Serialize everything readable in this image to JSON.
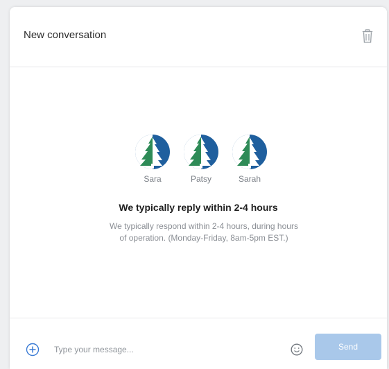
{
  "header": {
    "title": "New conversation",
    "delete_icon": "trash-icon"
  },
  "agents": [
    {
      "name": "Sara",
      "avatar_icon": "tree-logo-icon"
    },
    {
      "name": "Patsy",
      "avatar_icon": "tree-logo-icon"
    },
    {
      "name": "Sarah",
      "avatar_icon": "tree-logo-icon"
    }
  ],
  "availability": {
    "title": "We typically reply within 2-4 hours",
    "description_line1": "We typically respond within 2-4 hours, during hours",
    "description_line2": "of operation. (Monday-Friday, 8am-5pm EST.)"
  },
  "composer": {
    "placeholder": "Type your message...",
    "value": "",
    "send_label": "Send",
    "add_icon": "plus-circle-icon",
    "emoji_icon": "smiley-icon"
  },
  "colors": {
    "brand_blue": "#1f5f9e",
    "brand_green": "#2e8b57",
    "send_disabled": "#a9c8ea",
    "accent_bar": "#2f5f92"
  }
}
